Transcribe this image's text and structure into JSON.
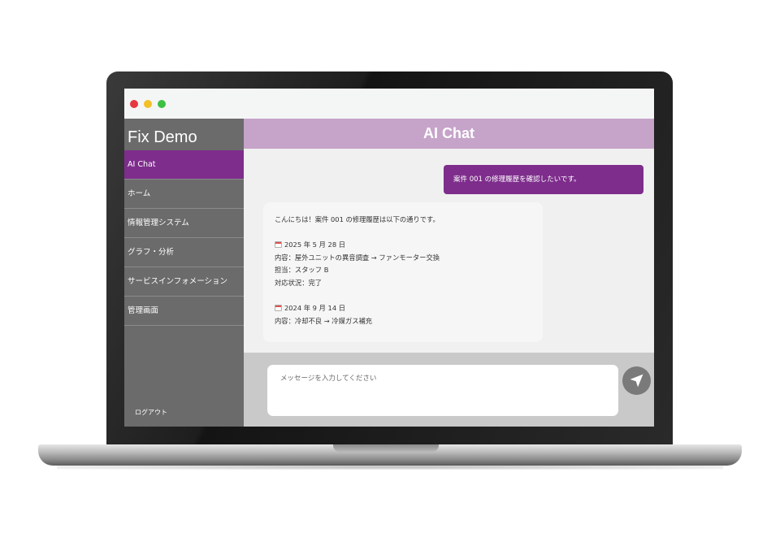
{
  "window": {
    "controls": [
      "close",
      "minimize",
      "maximize"
    ]
  },
  "sidebar": {
    "brand": "Fix Demo",
    "items": [
      {
        "label": "AI Chat",
        "active": true
      },
      {
        "label": "ホーム"
      },
      {
        "label": "情報管理システム"
      },
      {
        "label": "グラフ・分析"
      },
      {
        "label": "サービスインフォメーション"
      },
      {
        "label": "管理画面"
      }
    ],
    "logout": "ログアウト"
  },
  "chat": {
    "title": "AI Chat",
    "user_message": "案件 001 の修理履歴を確認したいです。",
    "bot_message": {
      "intro": "こんにちは！案件 001 の修理履歴は以下の通りです。",
      "entry1": {
        "date": "2025 年 5 月 28 日",
        "content": "内容：屋外ユニットの異音調査 → ファンモーター交換",
        "staff": "担当：スタッフ B",
        "status": "対応状況：完了"
      },
      "entry2": {
        "date": "2024 年 9 月 14 日",
        "content": "内容：冷却不良 → 冷媒ガス補充"
      }
    },
    "input_placeholder": "メッセージを入力してください"
  },
  "icons": {
    "calendar": "calendar-icon",
    "send": "send-icon"
  },
  "colors": {
    "accent": "#7e2d8c",
    "header": "#c6a3c9",
    "sidebar": "#6b6b6b",
    "input_area": "#c9c9c9"
  }
}
